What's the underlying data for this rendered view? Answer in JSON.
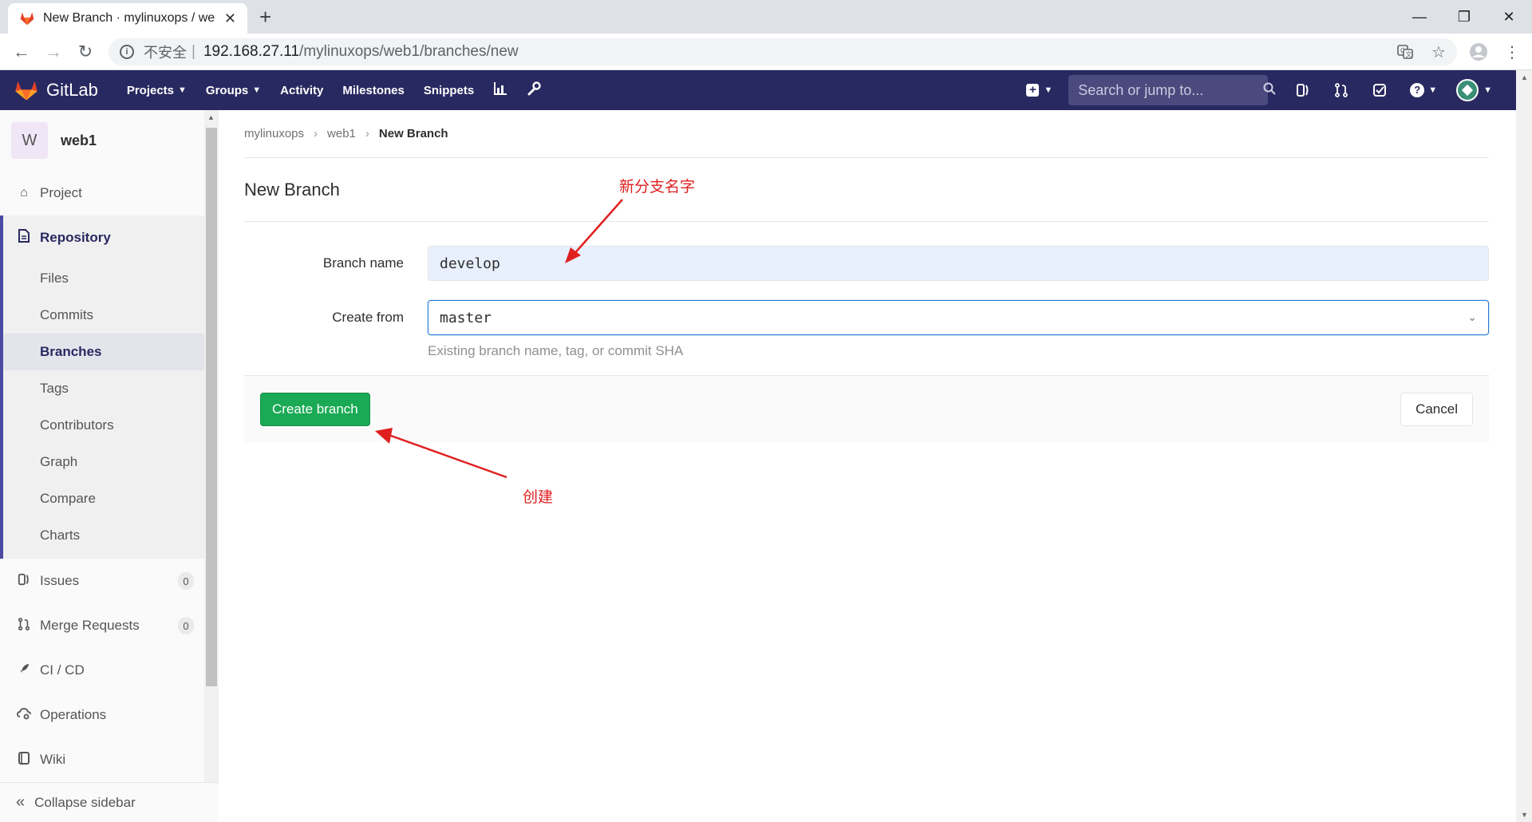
{
  "browser": {
    "tab_title": "New Branch · mylinuxops / we",
    "url_security": "不安全",
    "url_separator": "|",
    "url_host": "192.168.27.11",
    "url_path": "/mylinuxops/web1/branches/new"
  },
  "header": {
    "logo_text": "GitLab",
    "nav": [
      "Projects",
      "Groups",
      "Activity",
      "Milestones",
      "Snippets"
    ],
    "search_placeholder": "Search or jump to...",
    "brand_color": "#292961"
  },
  "sidebar": {
    "project_initial": "W",
    "project_name": "web1",
    "project_label": "Project",
    "repository_label": "Repository",
    "repository_items": [
      "Files",
      "Commits",
      "Branches",
      "Tags",
      "Contributors",
      "Graph",
      "Compare",
      "Charts"
    ],
    "active_item": "Branches",
    "issues_label": "Issues",
    "issues_count": "0",
    "merge_requests_label": "Merge Requests",
    "merge_requests_count": "0",
    "cicd_label": "CI / CD",
    "operations_label": "Operations",
    "wiki_label": "Wiki",
    "collapse_label": "Collapse sidebar"
  },
  "breadcrumb": [
    "mylinuxops",
    "web1",
    "New Branch"
  ],
  "page": {
    "title": "New Branch",
    "branch_name_label": "Branch name",
    "branch_name_value": "develop",
    "create_from_label": "Create from",
    "create_from_value": "master",
    "create_from_help": "Existing branch name, tag, or commit SHA",
    "create_button": "Create branch",
    "cancel_button": "Cancel",
    "create_button_color": "#1aaa55"
  },
  "annotations": {
    "branch_name_note": "新分支名字",
    "create_note": "创建",
    "color": "#e02020"
  }
}
